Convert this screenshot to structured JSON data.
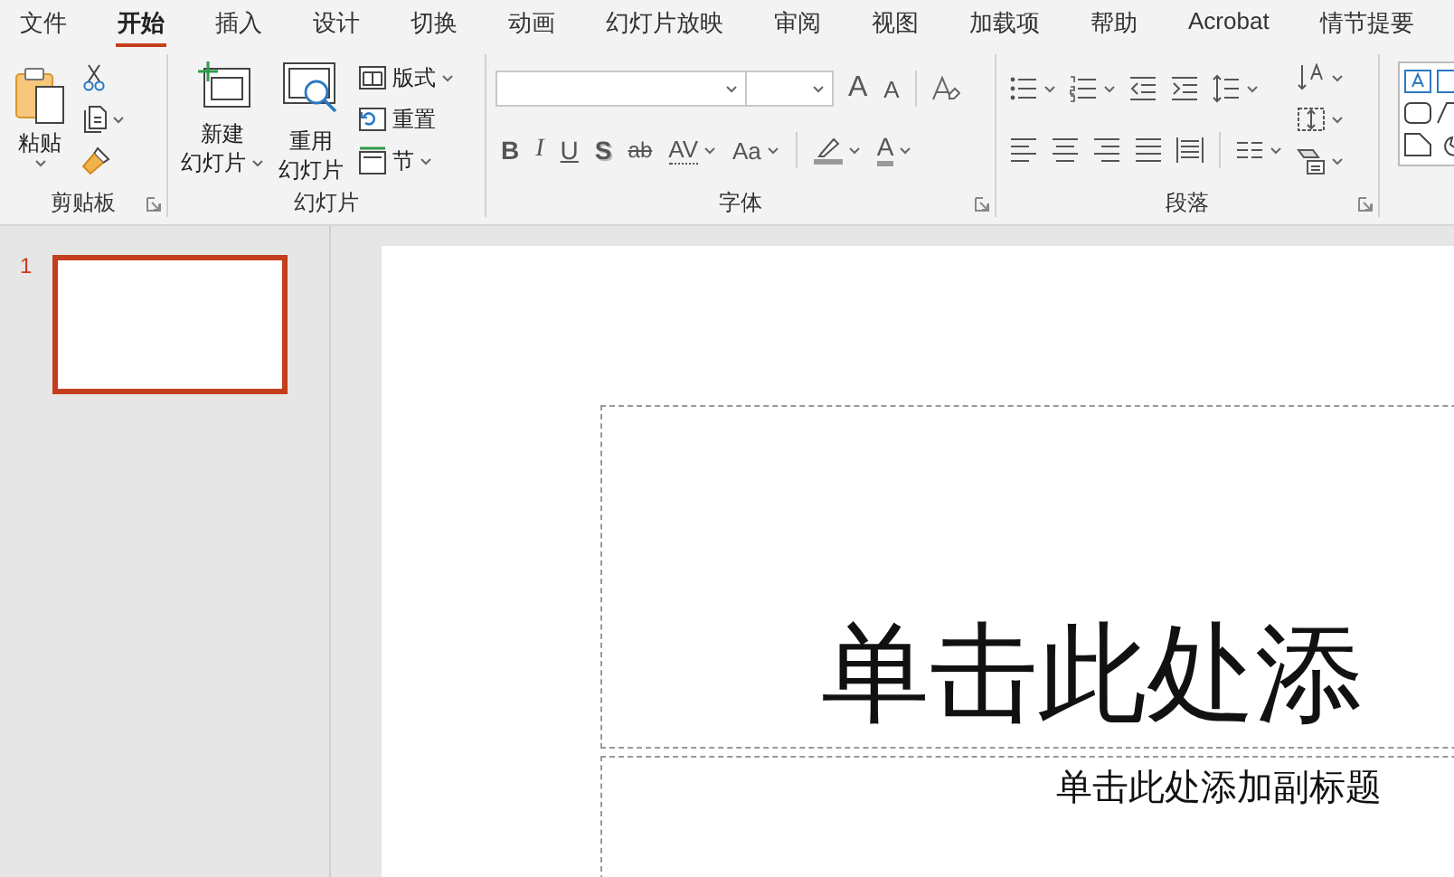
{
  "menu_tabs": [
    {
      "label": "文件",
      "selected": false
    },
    {
      "label": "开始",
      "selected": true
    },
    {
      "label": "插入",
      "selected": false
    },
    {
      "label": "设计",
      "selected": false
    },
    {
      "label": "切换",
      "selected": false
    },
    {
      "label": "动画",
      "selected": false
    },
    {
      "label": "幻灯片放映",
      "selected": false
    },
    {
      "label": "审阅",
      "selected": false
    },
    {
      "label": "视图",
      "selected": false
    },
    {
      "label": "加载项",
      "selected": false
    },
    {
      "label": "帮助",
      "selected": false
    },
    {
      "label": "Acrobat",
      "selected": false
    },
    {
      "label": "情节提要",
      "selected": false
    }
  ],
  "clipboard": {
    "label": "剪贴板",
    "launcher": true,
    "paste": "粘贴"
  },
  "slides_group": {
    "label": "幻灯片",
    "launcher": false,
    "large_buttons": [
      {
        "lines": [
          "新建",
          "幻灯片"
        ],
        "dropdown": true
      },
      {
        "lines": [
          "重用",
          "幻灯片"
        ],
        "dropdown": false
      }
    ],
    "small_buttons": [
      {
        "label": "版式",
        "dropdown": true
      },
      {
        "label": "重置",
        "dropdown": false
      },
      {
        "label": "节",
        "dropdown": true
      }
    ]
  },
  "font_group": {
    "label": "字体",
    "launcher": true,
    "size_buttons": [
      {
        "text": "A",
        "kind": "grow"
      },
      {
        "text": "A",
        "kind": "shrink"
      }
    ],
    "format_buttons": [
      {
        "text": "B",
        "kind": "bold",
        "dropdown": false
      },
      {
        "text": "I",
        "kind": "italic",
        "dropdown": false
      },
      {
        "text": "U",
        "kind": "underline",
        "dropdown": false
      },
      {
        "text": "S",
        "kind": "shadow",
        "dropdown": false
      },
      {
        "text": "ab",
        "kind": "strike",
        "dropdown": false
      },
      {
        "text": "AV",
        "kind": "spacing",
        "dropdown": true
      },
      {
        "text": "Aa",
        "kind": "case",
        "dropdown": true
      },
      {
        "kind": "highlight",
        "dropdown": true
      },
      {
        "text": "A",
        "kind": "color",
        "dropdown": true
      }
    ]
  },
  "paragraph_group": {
    "label": "段落",
    "launcher": true
  },
  "slides": [
    {
      "number": "1",
      "selected": true
    }
  ],
  "slide": {
    "title": "单击此处添",
    "subtitle": "单击此处添加副标题"
  }
}
